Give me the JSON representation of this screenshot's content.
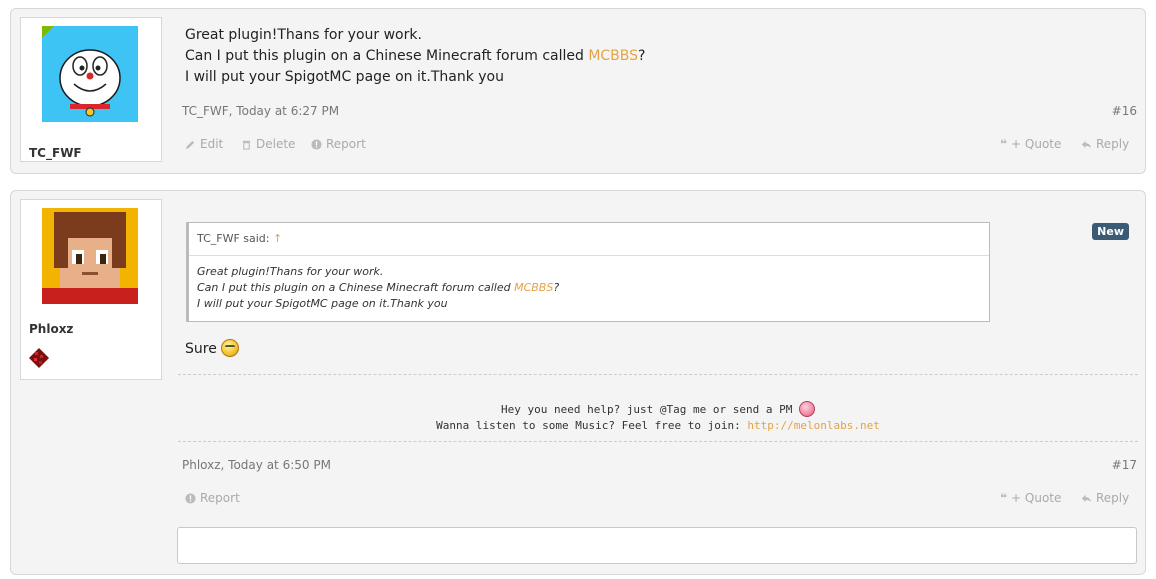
{
  "posts": [
    {
      "username": "TC_FWF",
      "lines": {
        "l1": "Great plugin!Thans for your work.",
        "l2a": "Can I put this plugin on a Chinese Minecraft forum called ",
        "l2link": "MCBBS",
        "l2b": "?",
        "l3": "I will put your SpigotMC page on it.Thank you"
      },
      "meta": "TC_FWF, Today at 6:27 PM",
      "number": "#16",
      "actions": {
        "edit": "Edit",
        "delete": "Delete",
        "report": "Report",
        "quote": "+ Quote",
        "reply": "Reply"
      }
    },
    {
      "username": "Phloxz",
      "badge": "New",
      "quote": {
        "author": "TC_FWF said:",
        "arrow": "↑",
        "l1": "Great plugin!Thans for your work.",
        "l2a": "Can I put this plugin on a Chinese Minecraft forum called ",
        "l2link": "MCBBS",
        "l2b": "?",
        "l3": "I will put your SpigotMC page on it.Thank you"
      },
      "message": "Sure",
      "signature": {
        "line1": "Hey you need help? just @Tag me or send a PM",
        "line2": "Wanna listen to some Music? Feel free to join: ",
        "link": "http://melonlabs.net"
      },
      "meta": "Phloxz, Today at 6:50 PM",
      "number": "#17",
      "actions": {
        "report": "Report",
        "quote": "+ Quote",
        "reply": "Reply"
      }
    }
  ],
  "colors": {
    "link": "#e4a344",
    "badge": "#3b5b75",
    "online": "#7fb900"
  }
}
